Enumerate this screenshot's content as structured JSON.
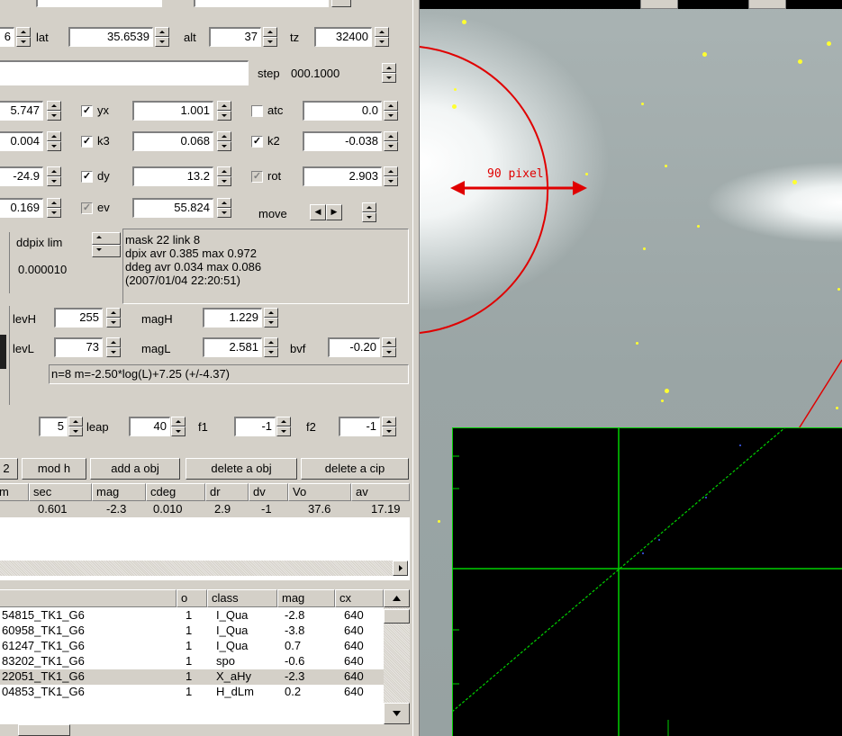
{
  "params": {
    "row1": {
      "lat_label": "lat",
      "lat": "35.6539",
      "alt_label": "alt",
      "alt": "37",
      "tz_label": "tz",
      "tz": "32400"
    },
    "step_label": "step",
    "step": "000.1000",
    "row_yx": {
      "left": "5.747",
      "label": "yx",
      "value": "1.001",
      "atc_label": "atc",
      "atc": "0.0"
    },
    "row_k3": {
      "left": "0.004",
      "label": "k3",
      "value": "0.068",
      "k2_label": "k2",
      "k2": "-0.038"
    },
    "row_dy": {
      "left": "-24.9",
      "label": "dy",
      "value": "13.2",
      "rot_label": "rot",
      "rot": "2.903"
    },
    "row_ev": {
      "left": "0.169",
      "label": "ev",
      "value": "55.824",
      "move_label": "move"
    }
  },
  "status": {
    "ddpix_label": "ddpix lim",
    "ddpix": "0.000010",
    "lines": [
      "mask 22  link 8",
      "dpix avr  0.385 max  0.972",
      "ddeg avr  0.034 max  0.086",
      "(2007/01/04 22:20:51)"
    ]
  },
  "levels": {
    "levH_label": "levH",
    "levH": "255",
    "magH_label": "magH",
    "magH": "1.229",
    "levL_label": "levL",
    "levL": "73",
    "magL_label": "magL",
    "magL": "2.581",
    "bvf_label": "bvf",
    "bvf": "-0.20",
    "formula": "n=8 m=-2.50*log(L)+7.25 (+/-4.37)"
  },
  "leap_row": {
    "first": "5",
    "leap_label": "leap",
    "leap": "40",
    "f1_label": "f1",
    "f1": "-1",
    "f2_label": "f2",
    "f2": "-1"
  },
  "buttons": {
    "partial": "2",
    "mod_h": "mod h",
    "add_obj": "add a obj",
    "delete_obj": "delete a obj",
    "delete_cip": "delete a cip"
  },
  "match_table": {
    "headers": [
      "m",
      "sec",
      "mag",
      "cdeg",
      "dr",
      "dv",
      "Vo",
      "av"
    ],
    "row": [
      "0.601",
      "-2.3",
      "0.010",
      "2.9",
      "-1",
      "37.6",
      "17.19"
    ]
  },
  "object_list": {
    "headers": [
      "o",
      "class",
      "mag",
      "cx"
    ],
    "rows": [
      {
        "name": "54815_TK1_G6",
        "o": "1",
        "class": "I_Qua",
        "mag": "-2.8",
        "cx": "640"
      },
      {
        "name": "60958_TK1_G6",
        "o": "1",
        "class": "I_Qua",
        "mag": "-3.8",
        "cx": "640"
      },
      {
        "name": "61247_TK1_G6",
        "o": "1",
        "class": "I_Qua",
        "mag": "0.7",
        "cx": "640"
      },
      {
        "name": "83202_TK1_G6",
        "o": "1",
        "class": "spo",
        "mag": "-0.6",
        "cx": "640"
      },
      {
        "name": "22051_TK1_G6",
        "o": "1",
        "class": "X_aHy",
        "mag": "-2.3",
        "cx": "640"
      },
      {
        "name": "04853_TK1_G6",
        "o": "1",
        "class": "H_dLm",
        "mag": "0.2",
        "cx": "640"
      }
    ]
  },
  "image_view": {
    "annotation": "90 pixel"
  },
  "colors": {
    "panel": "#d4d0c8",
    "circle": "#e00000",
    "plot_grid": "#00d000",
    "stars": "#ffff30"
  }
}
